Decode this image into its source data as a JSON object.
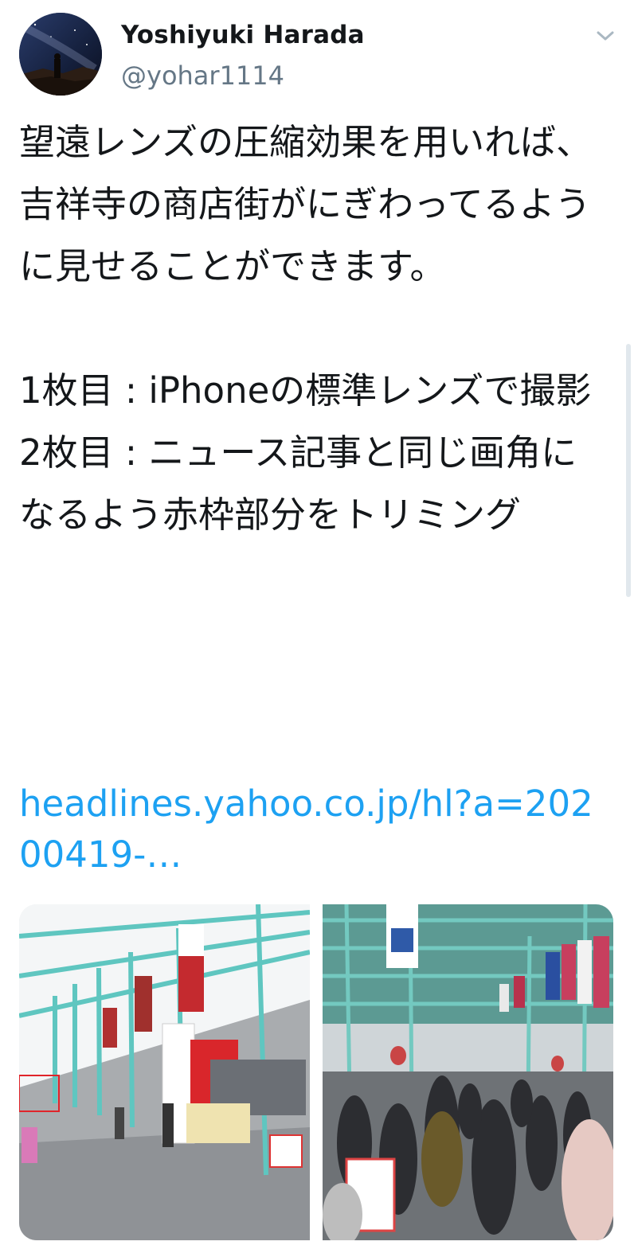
{
  "tweet": {
    "author": {
      "display_name": "Yoshiyuki Harada",
      "handle": "@yohar1114",
      "avatar_icon": "avatar-night-sky-icon"
    },
    "menu_icon": "chevron-down-icon",
    "text": "望遠レンズの圧縮効果を用いれば、吉祥寺の商店街がにぎわってるように見せることができます。\n\n1枚目 : iPhoneの標準レンズで撮影\n2枚目 : ニュース記事と同じ画角になるよう赤枠部分をトリミング",
    "link": "headlines.yahoo.co.jp/hl?a=20200419-…",
    "colors": {
      "link": "#1da1f2",
      "handle": "#657786",
      "text": "#14171a"
    }
  }
}
